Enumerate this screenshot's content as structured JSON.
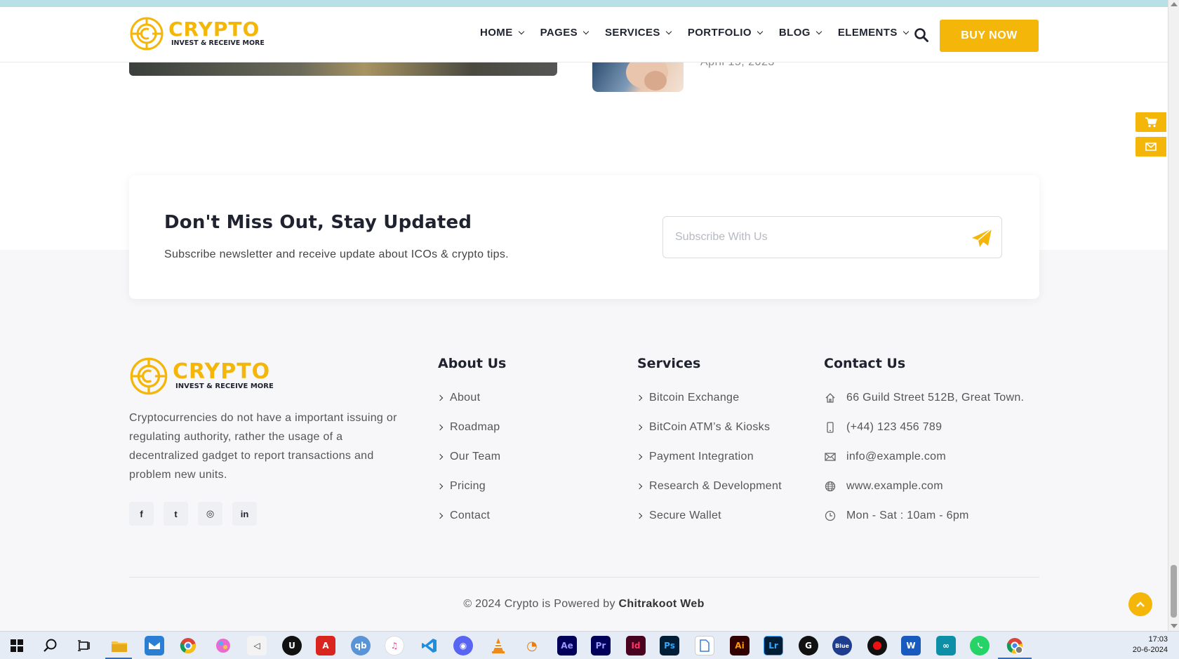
{
  "header": {
    "logo": {
      "brand": "CRYPTO",
      "tagline": "INVEST & RECEIVE MORE"
    },
    "nav": [
      {
        "label": "HOME"
      },
      {
        "label": "PAGES"
      },
      {
        "label": "SERVICES"
      },
      {
        "label": "PORTFOLIO"
      },
      {
        "label": "BLOG"
      },
      {
        "label": "ELEMENTS"
      }
    ],
    "search_icon": "search-icon",
    "buy_label": "BUY NOW"
  },
  "blog_partial": {
    "date": "April 15, 2023"
  },
  "side_widgets": [
    "cart-icon",
    "mail-icon"
  ],
  "newsletter": {
    "title": "Don't Miss Out, Stay Updated",
    "subtitle": "Subscribe newsletter and receive update about ICOs & crypto tips.",
    "placeholder": "Subscribe With Us",
    "send_icon": "paper-plane-icon"
  },
  "footer": {
    "logo": {
      "brand": "CRYPTO",
      "tagline": "INVEST & RECEIVE MORE"
    },
    "about_text": "Cryptocurrencies do not have a important issuing or regulating authority, rather the usage of a decentralized gadget to report transactions and problem new units.",
    "social": [
      {
        "icon": "facebook-icon",
        "glyph": "f"
      },
      {
        "icon": "twitter-icon",
        "glyph": "t"
      },
      {
        "icon": "instagram-icon",
        "glyph": "◎"
      },
      {
        "icon": "linkedin-icon",
        "glyph": "in"
      }
    ],
    "about_title": "About Us",
    "about_links": [
      "About",
      "Roadmap",
      "Our Team",
      "Pricing",
      "Contact"
    ],
    "services_title": "Services",
    "services_links": [
      "Bitcoin Exchange",
      "BitCoin ATM’s & Kiosks",
      "Payment Integration",
      "Research & Development",
      "Secure Wallet"
    ],
    "contact_title": "Contact Us",
    "contact": [
      {
        "icon": "home-icon",
        "text": "66 Guild Street 512B, Great Town."
      },
      {
        "icon": "phone-icon",
        "text": "(+44) 123 456 789"
      },
      {
        "icon": "envelope-icon",
        "text": "info@example.com"
      },
      {
        "icon": "globe-icon",
        "text": "www.example.com"
      },
      {
        "icon": "clock-icon",
        "text": "Mon - Sat : 10am - 6pm"
      }
    ],
    "copyright_prefix": "© 2024 Crypto is Powered by ",
    "copyright_link": "Chitrakoot Web"
  },
  "taskbar": {
    "apps": [
      {
        "name": "start-icon",
        "label": ""
      },
      {
        "name": "search-icon",
        "label": ""
      },
      {
        "name": "task-view-icon",
        "label": ""
      },
      {
        "name": "file-explorer-icon",
        "label": ""
      },
      {
        "name": "mail-app-icon",
        "label": ""
      },
      {
        "name": "chrome-icon",
        "label": ""
      },
      {
        "name": "paint-icon",
        "label": ""
      },
      {
        "name": "visual-studio-icon",
        "label": ""
      },
      {
        "name": "unreal-icon",
        "label": "U"
      },
      {
        "name": "acrobat-icon",
        "label": ""
      },
      {
        "name": "qbittorrent-icon",
        "label": "qb"
      },
      {
        "name": "itunes-icon",
        "label": "♫"
      },
      {
        "name": "vscode-icon",
        "label": ""
      },
      {
        "name": "discord-icon",
        "label": ""
      },
      {
        "name": "vlc-icon",
        "label": ""
      },
      {
        "name": "blender-icon",
        "label": ""
      },
      {
        "name": "after-effects-icon",
        "label": "Ae"
      },
      {
        "name": "premiere-icon",
        "label": "Pr"
      },
      {
        "name": "indesign-icon",
        "label": "Id"
      },
      {
        "name": "photoshop-icon",
        "label": "Ps"
      },
      {
        "name": "document-icon",
        "label": ""
      },
      {
        "name": "illustrator-icon",
        "label": "Ai"
      },
      {
        "name": "lightroom-icon",
        "label": "Lr"
      },
      {
        "name": "app-g-icon",
        "label": "G"
      },
      {
        "name": "bluestacks-icon",
        "label": "Blue"
      },
      {
        "name": "recorder-icon",
        "label": ""
      },
      {
        "name": "word-icon",
        "label": "W"
      },
      {
        "name": "app-teal-icon",
        "label": ""
      },
      {
        "name": "whatsapp-icon",
        "label": ""
      },
      {
        "name": "chrome-profile-icon",
        "label": ""
      }
    ],
    "time": "17:03",
    "date": "20-6-2024"
  },
  "colors": {
    "accent": "#f5b60a",
    "dark": "#1f2330",
    "muted": "#555555"
  }
}
